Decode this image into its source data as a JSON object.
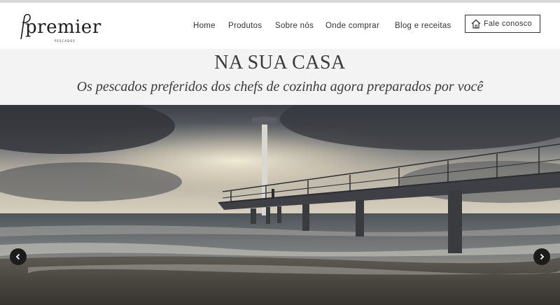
{
  "brand": {
    "logo_text": "premier",
    "logo_sub": "PESCADOS"
  },
  "nav": {
    "items": [
      "Home",
      "Produtos",
      "Sobre nós",
      "Onde comprar",
      "Blog e receitas"
    ],
    "contact_label": "Fale conosco"
  },
  "intro": {
    "title": "NA SUA CASA",
    "subtitle": "Os pescados preferidos dos chefs de cozinha agora preparados por você"
  },
  "carousel": {
    "prev_icon": "chevron-left-icon",
    "next_icon": "chevron-right-icon"
  },
  "colors": {
    "text": "#333333",
    "intro_bg": "#f3f3f3",
    "arrow_bg": "#1c1c1c"
  }
}
